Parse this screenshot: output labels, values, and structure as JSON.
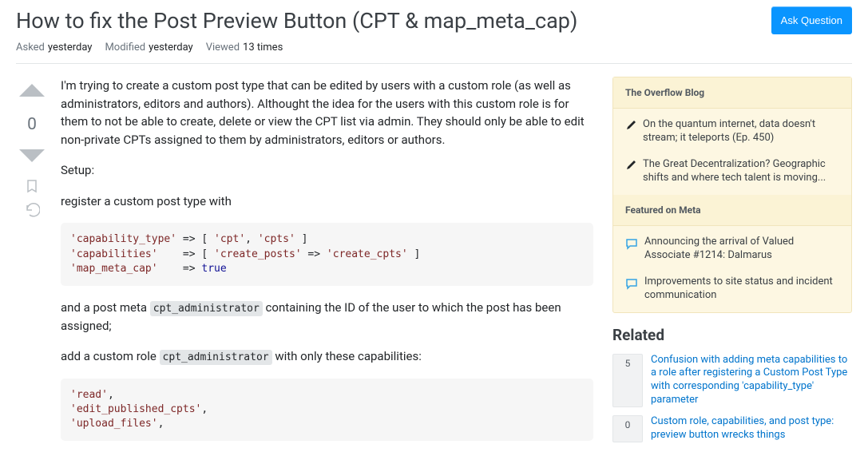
{
  "header": {
    "title": "How to fix the Post Preview Button (CPT & map_meta_cap)",
    "ask_button": "Ask Question"
  },
  "meta": {
    "asked_label": "Asked",
    "asked_value": "yesterday",
    "modified_label": "Modified",
    "modified_value": "yesterday",
    "viewed_label": "Viewed",
    "viewed_value": "13 times"
  },
  "vote": {
    "score": "0"
  },
  "post": {
    "para1": "I'm trying to create a custom post type that can be edited by users with a custom role (as well as administrators, editors and authors). Althought the idea for the users with this custom role is for them to not be able to create, delete or view the CPT list via admin. They should only be able to edit non-private CPTs assigned to them by administrators, editors or authors.",
    "para2": "Setup:",
    "para3": "register a custom post type with",
    "code1_raw": "'capability_type' => [ 'cpt', 'cpts' ]\n'capabilities'    => [ 'create_posts' => 'create_cpts' ]\n'map_meta_cap'    => true",
    "para4_a": "and a post meta ",
    "para4_code": "cpt_administrator",
    "para4_b": " containing the ID of the user to which the post has been assigned;",
    "para5_a": "add a custom role ",
    "para5_code": "cpt_administrator",
    "para5_b": " with only these capabilities:",
    "code2_raw": "'read',\n'edit_published_cpts',\n'upload_files',"
  },
  "sidebar": {
    "overflow_title": "The Overflow Blog",
    "overflow_items": [
      "On the quantum internet, data doesn't stream; it teleports (Ep. 450)",
      "The Great Decentralization? Geographic shifts and where tech talent is moving..."
    ],
    "meta_title": "Featured on Meta",
    "meta_items": [
      "Announcing the arrival of Valued Associate #1214: Dalmarus",
      "Improvements to site status and incident communication"
    ],
    "related_title": "Related",
    "related": [
      {
        "score": "5",
        "text": "Confusion with adding meta capabilities to a role after registering a Custom Post Type with corresponding 'capability_type' parameter"
      },
      {
        "score": "0",
        "text": "Custom role, capabilities, and post type: preview button wrecks things"
      }
    ]
  }
}
